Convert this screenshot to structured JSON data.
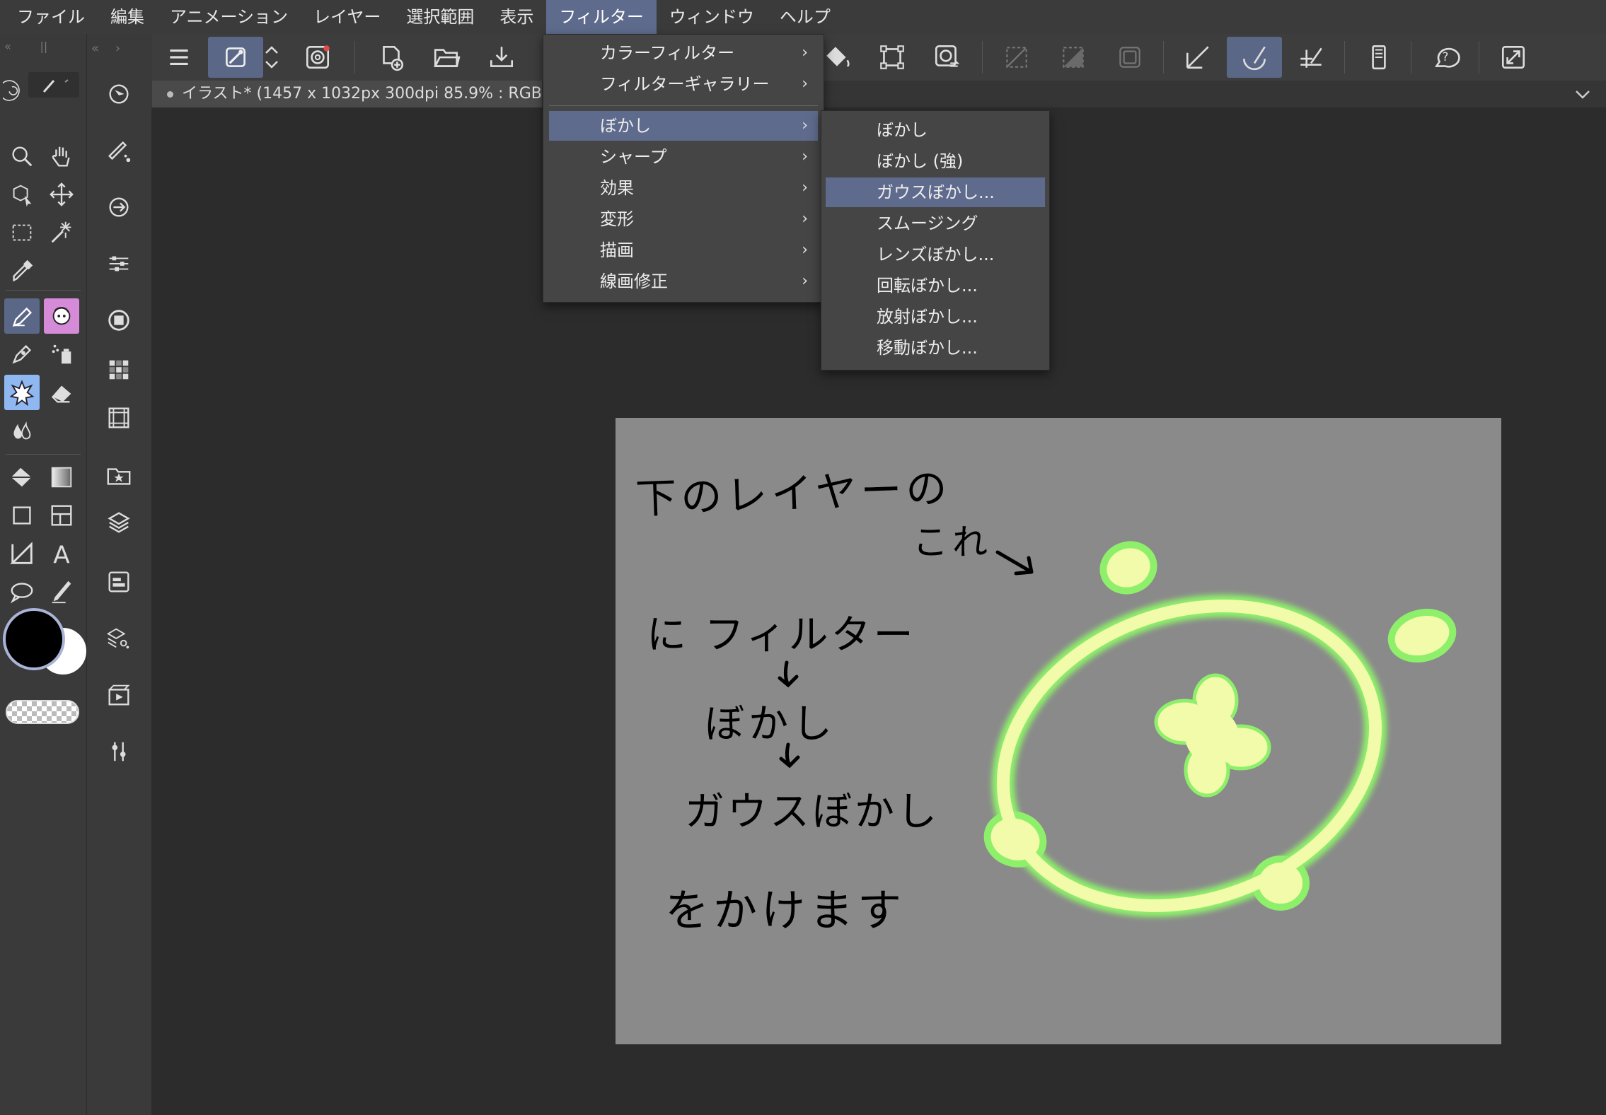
{
  "menubar": {
    "items": [
      "ファイル",
      "編集",
      "アニメーション",
      "レイヤー",
      "選択範囲",
      "表示",
      "フィルター",
      "ウィンドウ",
      "ヘルプ"
    ],
    "active": "フィルター"
  },
  "document_tab": {
    "label": "イラスト* (1457 x 1032px 300dpi 85.9% : RGB:sRGB"
  },
  "filter_menu": {
    "items": [
      "カラーフィルター",
      "フィルターギャラリー",
      "ぼかし",
      "シャープ",
      "効果",
      "変形",
      "描画",
      "線画修正"
    ],
    "highlighted": "ぼかし"
  },
  "blur_submenu": {
    "items": [
      "ぼかし",
      "ぼかし (強)",
      "ガウスぼかし...",
      "スムージング",
      "レンズぼかし...",
      "回転ぼかし...",
      "放射ぼかし...",
      "移動ぼかし..."
    ],
    "highlighted": "ガウスぼかし..."
  },
  "canvas": {
    "handwritten_lines": [
      "下のレイヤーの",
      "これ",
      "に フィルター",
      "ぼかし",
      "ガウスぼかし",
      "をかけます"
    ]
  },
  "colors": {
    "menu_highlight": "#5e6b8c",
    "canvas_bg": "#8a8a8a",
    "glow_green": "#8ef06a",
    "fill_yellow": "#f1fbaa",
    "main_color": "#000000",
    "sub_color": "#ffffff"
  },
  "icons": {
    "toolbar": [
      "hamburger-icon",
      "stabilizer-icon",
      "updown-arrows-icon",
      "spiral-icon",
      "new-canvas-icon",
      "open-folder-icon",
      "save-icon",
      "fill-bucket-icon",
      "transform-icon",
      "selection-convert-icon",
      "clear-selection-icon",
      "invert-selection-icon",
      "selection-border-icon",
      "ruler-snap-icon",
      "special-ruler-snap-icon",
      "grid-snap-icon",
      "smartphone-icon",
      "help-icon",
      "expand-icon"
    ],
    "tools": [
      "zoom-icon",
      "hand-icon",
      "object-icon",
      "move-icon",
      "marquee-icon",
      "magic-wand-icon",
      "eyedropper-icon",
      "pen-icon",
      "pen-sub-tool-icon",
      "pencil-icon",
      "airbrush-icon",
      "decoration-icon",
      "eraser-icon",
      "blend-icon",
      "fill-icon",
      "gradient-icon",
      "figure-icon",
      "frame-icon",
      "ruler-icon",
      "text-icon",
      "balloon-icon",
      "correct-line-icon"
    ],
    "palettes": [
      "navigator-icon",
      "brush-size-icon",
      "transform-palette-icon",
      "tool-property-icon",
      "color-circle-icon",
      "color-set-icon",
      "material-icon",
      "layer-icon",
      "layer-property-icon",
      "layer-search-icon",
      "animation-icon",
      "adjust-icon"
    ]
  }
}
